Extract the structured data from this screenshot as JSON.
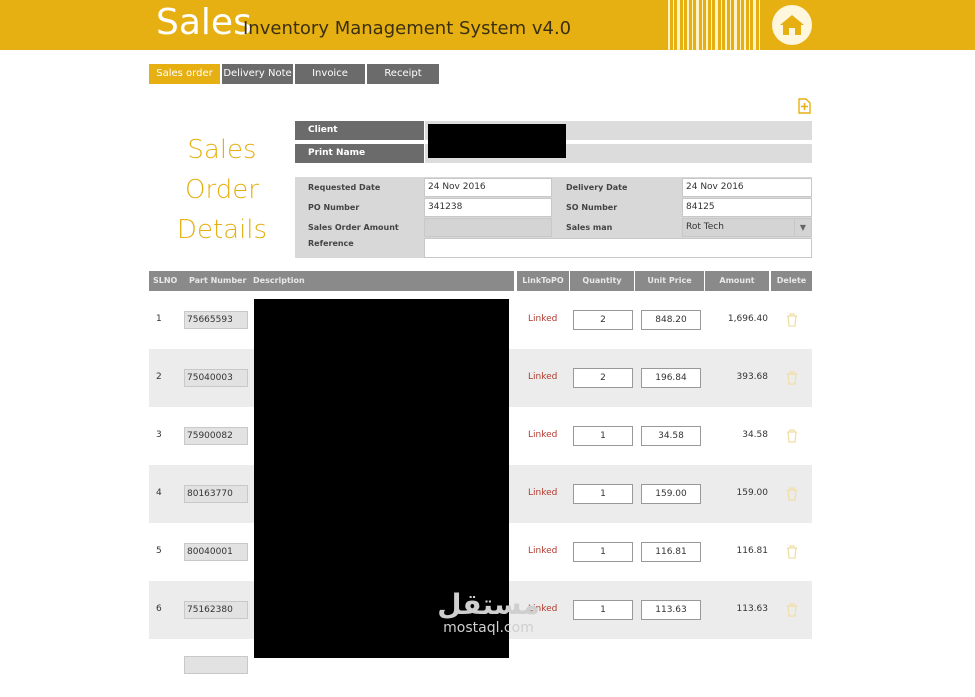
{
  "app": {
    "brand_big": "Sales",
    "brand_rest": "Inventory Management System v4.0",
    "accent_color": "#e6b012"
  },
  "tabs": [
    {
      "label": "Sales order",
      "active": true
    },
    {
      "label": "Delivery Note",
      "active": false
    },
    {
      "label": "Invoice",
      "active": false
    },
    {
      "label": "Receipt",
      "active": false
    }
  ],
  "section_title": [
    "Sales",
    "Order",
    "Details"
  ],
  "client": {
    "client_label": "Client",
    "print_name_label": "Print Name"
  },
  "form": {
    "requested_date_label": "Requested Date",
    "requested_date": "24 Nov 2016",
    "delivery_date_label": "Delivery Date",
    "delivery_date": "24 Nov 2016",
    "po_number_label": "PO Number",
    "po_number": "341238",
    "so_number_label": "SO Number",
    "so_number": "84125",
    "sales_order_amount_label": "Sales Order Amount",
    "sales_man_label": "Sales man",
    "sales_man": "Rot Tech",
    "reference_label": "Reference"
  },
  "table": {
    "headers": {
      "slno": "SLNO",
      "part_number": "Part Number",
      "description": "Description",
      "link_to_po": "LinkToPO",
      "quantity": "Quantity",
      "unit_price": "Unit Price",
      "amount": "Amount",
      "delete": "Delete"
    },
    "rows": [
      {
        "slno": "1",
        "part_number": "75665593",
        "link": "Linked",
        "quantity": "2",
        "unit_price": "848.20",
        "amount": "1,696.40"
      },
      {
        "slno": "2",
        "part_number": "75040003",
        "link": "Linked",
        "quantity": "2",
        "unit_price": "196.84",
        "amount": "393.68"
      },
      {
        "slno": "3",
        "part_number": "75900082",
        "link": "Linked",
        "quantity": "1",
        "unit_price": "34.58",
        "amount": "34.58"
      },
      {
        "slno": "4",
        "part_number": "80163770",
        "link": "Linked",
        "quantity": "1",
        "unit_price": "159.00",
        "amount": "159.00"
      },
      {
        "slno": "5",
        "part_number": "80040001",
        "link": "Linked",
        "quantity": "1",
        "unit_price": "116.81",
        "amount": "116.81"
      },
      {
        "slno": "6",
        "part_number": "75162380",
        "link": "Linked",
        "quantity": "1",
        "unit_price": "113.63",
        "amount": "113.63"
      }
    ]
  },
  "watermark": {
    "arabic": "مستقل",
    "latin": "mostaql.com"
  }
}
